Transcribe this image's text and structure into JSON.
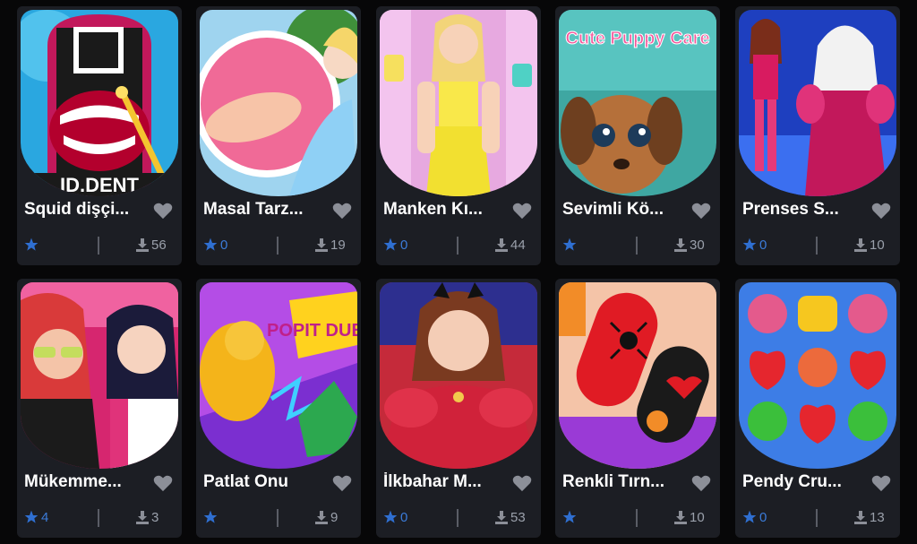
{
  "colors": {
    "background": "#070708",
    "card": "#1c1e24",
    "star": "#2f6fd1",
    "heart": "#8c8f98",
    "download_icon": "#8c8f98"
  },
  "games": [
    {
      "title": "Squid dişçi...",
      "rating": "",
      "downloads": "56",
      "thumb_text": "ID.DENT"
    },
    {
      "title": "Masal Tarz...",
      "rating": "0",
      "downloads": "19"
    },
    {
      "title": "Manken Kı...",
      "rating": "0",
      "downloads": "44"
    },
    {
      "title": "Sevimli Kö...",
      "rating": "",
      "downloads": "30",
      "thumb_text": "Cute Puppy Care"
    },
    {
      "title": "Prenses S...",
      "rating": "0",
      "downloads": "10"
    },
    {
      "title": "Mükemme...",
      "rating": "4",
      "downloads": "3"
    },
    {
      "title": "Patlat Onu",
      "rating": "",
      "downloads": "9",
      "thumb_text": "POPIT DUEL"
    },
    {
      "title": "İlkbahar M...",
      "rating": "0",
      "downloads": "53"
    },
    {
      "title": "Renkli Tırn...",
      "rating": "",
      "downloads": "10"
    },
    {
      "title": "Pendy Cru...",
      "rating": "0",
      "downloads": "13"
    }
  ]
}
